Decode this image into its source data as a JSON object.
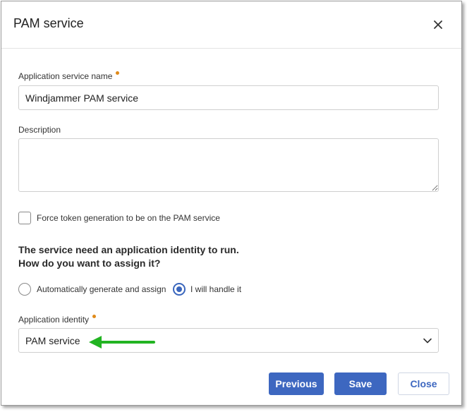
{
  "dialog": {
    "title": "PAM service"
  },
  "form": {
    "service_name": {
      "label": "Application service name",
      "value": "Windjammer PAM service",
      "required": true
    },
    "description": {
      "label": "Description",
      "value": ""
    },
    "force_token": {
      "label": "Force token generation to be on the PAM service",
      "checked": false
    },
    "identity_question": {
      "line1": "The service need an application identity to run.",
      "line2": "How do you want to assign it?"
    },
    "assign_options": [
      {
        "label": "Automatically generate and assign",
        "selected": false
      },
      {
        "label": "I will handle it",
        "selected": true
      }
    ],
    "application_identity": {
      "label": "Application identity",
      "value": "PAM service",
      "required": true
    }
  },
  "footer": {
    "previous_label": "Previous",
    "save_label": "Save",
    "close_label": "Close"
  },
  "colors": {
    "primary": "#3d67c0",
    "required_dot": "#e08a1a",
    "annotation_arrow": "#22b422"
  },
  "icons": {
    "close": "close-icon",
    "dropdown": "chevron-down-icon",
    "annotation": "arrow-left-icon"
  }
}
